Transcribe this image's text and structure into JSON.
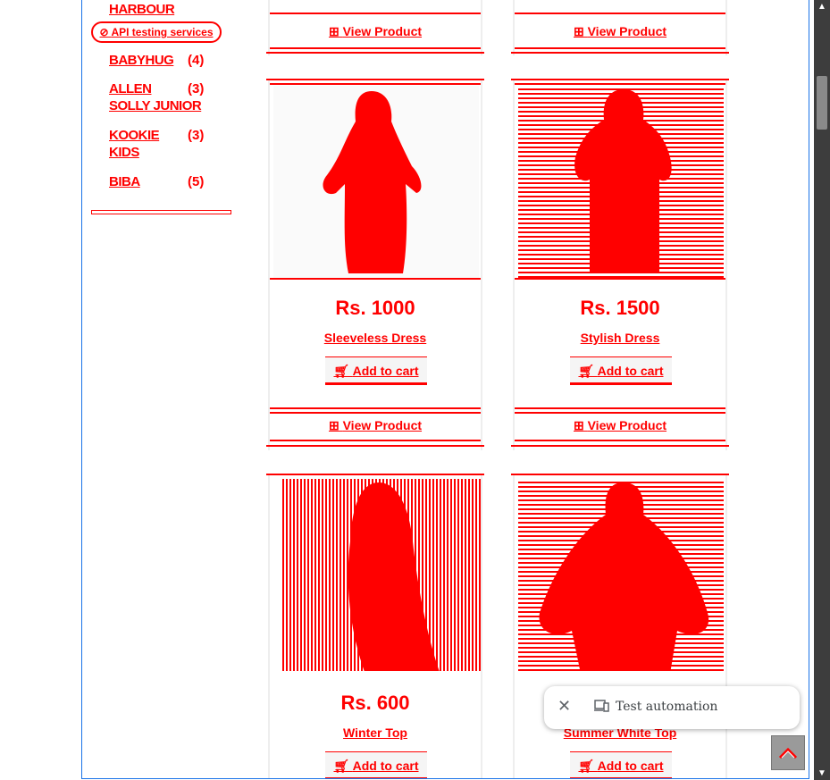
{
  "sidebar": {
    "top_brand": "HARBOUR",
    "ad_label": "API testing services",
    "brands": [
      {
        "name_line1": "BABYHUG",
        "name_line2": "",
        "count": "(4)"
      },
      {
        "name_line1": "ALLEN",
        "name_line2": "SOLLY JUNIOR",
        "count": "(3)"
      },
      {
        "name_line1": "KOOKIE",
        "name_line2": "KIDS",
        "count": "(3)"
      },
      {
        "name_line1": "BIBA",
        "name_line2": "",
        "count": "(5)"
      }
    ]
  },
  "products": [
    {
      "price": "",
      "name": "",
      "cart_label": "",
      "view_label": "View Product"
    },
    {
      "price": "",
      "name": "",
      "cart_label": "",
      "view_label": "View Product"
    },
    {
      "price": "Rs. 1000",
      "name": "Sleeveless Dress",
      "cart_label": "Add to cart",
      "view_label": "View Product"
    },
    {
      "price": "Rs. 1500",
      "name": "Stylish Dress",
      "cart_label": "Add to cart",
      "view_label": "View Product"
    },
    {
      "price": "Rs. 600",
      "name": "Winter Top",
      "cart_label": "Add to cart",
      "view_label": ""
    },
    {
      "price": "",
      "name": "Summer White Top",
      "cart_label": "Add to cart",
      "view_label": ""
    }
  ],
  "toast": {
    "label": "Test automation"
  },
  "colors": {
    "accent": "#ff0000",
    "frame_border": "#1a73e8"
  },
  "icons": {
    "view": "view-product-icon",
    "cart": "shopping-cart-icon",
    "ad": "ad-link-icon",
    "close": "close-icon",
    "device": "devices-icon",
    "scroll_top": "chevron-up-icon"
  }
}
